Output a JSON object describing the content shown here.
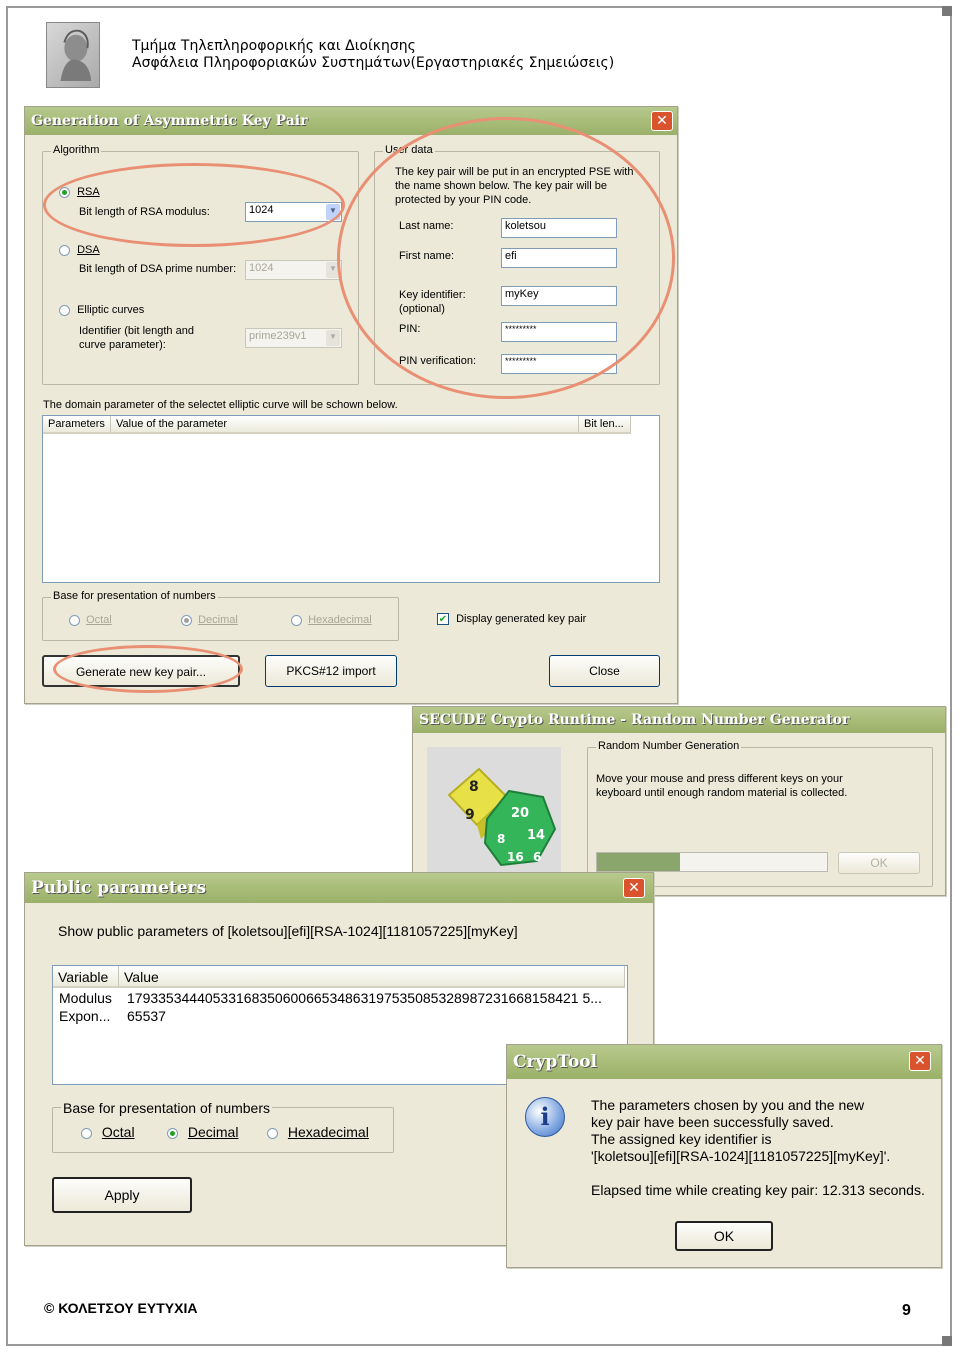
{
  "header": {
    "line1": "Τμήμα Τηλεπληροφορικής και Διοίκησης",
    "line2": "Ασφάλεια Πληροφοριακών Συστημάτων(Εργαστηριακές Σημειώσεις)"
  },
  "keypair_dialog": {
    "title": "Generation of Asymmetric Key Pair",
    "close_glyph": "✕",
    "algorithm": {
      "group_label": "Algorithm",
      "rsa_label": "RSA",
      "rsa_modulus_label": "Bit length of RSA modulus:",
      "rsa_modulus_value": "1024",
      "dsa_label": "DSA",
      "dsa_prime_label": "Bit length of DSA prime number:",
      "dsa_prime_value": "1024",
      "ec_label": "Elliptic curves",
      "ec_identifier_label_1": "Identifier (bit length and",
      "ec_identifier_label_2": "curve parameter):",
      "ec_identifier_value": "prime239v1"
    },
    "user_data": {
      "group_label": "User data",
      "desc_1": "The key pair will be put in an encrypted PSE with",
      "desc_2": "the name shown below. The key pair will be",
      "desc_3": "protected by your PIN code.",
      "last_name_label": "Last name:",
      "last_name_value": "koletsou",
      "first_name_label": "First name:",
      "first_name_value": "efi",
      "key_id_label_1": "Key identifier:",
      "key_id_label_2": "(optional)",
      "key_id_value": "myKey",
      "pin_label": "PIN:",
      "pin_value": "*********",
      "pin_verify_label": "PIN verification:",
      "pin_verify_value": "*********"
    },
    "domain_text": "The domain parameter of the selectet elliptic curve will be schown below.",
    "columns": [
      "Parameters",
      "Value of the parameter",
      "Bit len..."
    ],
    "base_group_label": "Base for presentation of numbers",
    "base_options": [
      "Octal",
      "Decimal",
      "Hexadecimal"
    ],
    "display_checkbox_label": "Display generated key pair",
    "buttons": {
      "generate": "Generate new key pair...",
      "pkcs": "PKCS#12 import",
      "close": "Close"
    }
  },
  "rng_dialog": {
    "title": "SECUDE Crypto Runtime - Random Number Generator",
    "group_label": "Random Number Generation",
    "text_1": "Move your mouse and press different keys on your",
    "text_2": "keyboard until enough random material is collected.",
    "progress": 0.36,
    "ok_label": "OK",
    "dice_labels": [
      "8",
      "20",
      "14",
      "9",
      "16",
      "8",
      "6"
    ]
  },
  "public_dialog": {
    "title": "Public parameters",
    "close_glyph": "✕",
    "show_text": "Show public parameters of [koletsou][efi][RSA-1024][1181057225][myKey]",
    "columns": [
      "Variable",
      "Value"
    ],
    "rows": [
      {
        "variable": "Modulus",
        "value": "1793353444053316835060066534863197535085328987231668158421 5..."
      },
      {
        "variable": "Expon...",
        "value": "65537"
      }
    ],
    "base_group_label": "Base for presentation of numbers",
    "base_options": [
      "Octal",
      "Decimal",
      "Hexadecimal"
    ],
    "apply_label": "Apply"
  },
  "cryptool_dialog": {
    "title": "CrypTool",
    "close_glyph": "✕",
    "info_glyph": "i",
    "msg_1": "The parameters chosen by you and the new",
    "msg_2": "key pair have been successfully saved.",
    "msg_3": "The assigned key identifier is",
    "msg_4": "'[koletsou][efi][RSA-1024][1181057225][myKey]'.",
    "msg_5": "Elapsed time while creating key pair: 12.313 seconds.",
    "ok_label": "OK"
  },
  "footer": {
    "copyright": "© ΚΟΛΕΤΣΟΥ ΕΥΤΥΧΙΑ",
    "page_number": "9"
  }
}
